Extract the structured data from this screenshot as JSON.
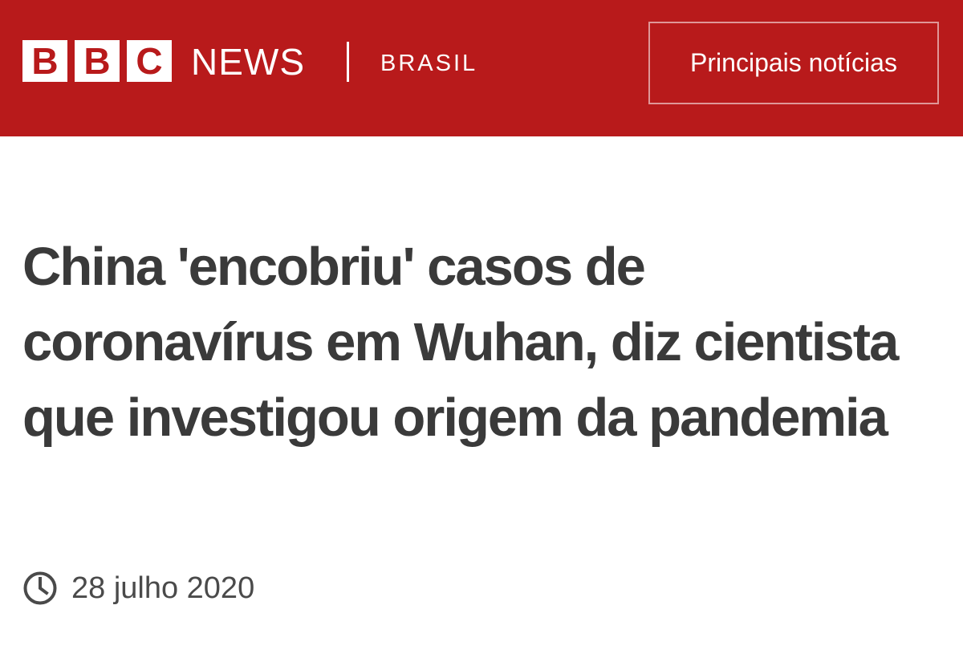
{
  "header": {
    "brand_letters": [
      "B",
      "B",
      "C"
    ],
    "brand_name": "NEWS",
    "edition": "BRASIL",
    "top_stories_label": "Principais notícias",
    "background_color": "#b81a1b"
  },
  "article": {
    "headline": "China 'encobriu' casos de coronavírus em Wuhan, diz cientista que investigou origem da pandemia",
    "date_icon": "clock-icon",
    "date": "28 julho 2020"
  }
}
